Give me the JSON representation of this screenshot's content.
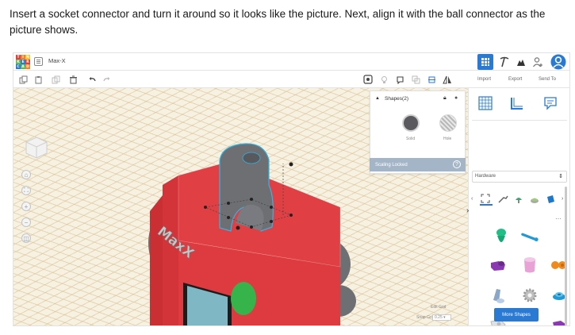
{
  "instruction": "Insert a socket connector and turn it around so it looks like the picture. Next, align it with the ball connector as the picture shows.",
  "app": {
    "logo_letters": [
      "T",
      "I",
      "N",
      "K",
      "E",
      "R",
      "C",
      "A",
      "D"
    ],
    "logo_colors": [
      "#e2403b",
      "#f58220",
      "#f6c322",
      "#5ab75a",
      "#2a7ad4",
      "#e2403b",
      "#2a7ad4",
      "#5ab75a",
      "#f58220"
    ],
    "project_name": "Max-X",
    "accent_color": "#2a7ad4"
  },
  "toolbar": {
    "import_label": "Import",
    "export_label": "Export",
    "send_to_label": "Send To"
  },
  "shapes_panel": {
    "title": "Shapes(2)",
    "solid_label": "Solid",
    "hole_label": "Hole",
    "scaling_label": "Scaling Locked"
  },
  "library": {
    "category": "Hardware"
  },
  "bottom": {
    "edit_grid_label": "Edit Grid",
    "snap_grid_label": "Snap Grid",
    "snap_grid_value": "0.25",
    "more_shapes_label": "More Shapes"
  },
  "model": {
    "body_color": "#dd3b3f",
    "gray_color": "#6e6f73",
    "green_color": "#36b34a",
    "screen_color": "#7fb7c4",
    "text_on_body": "MaxX"
  }
}
